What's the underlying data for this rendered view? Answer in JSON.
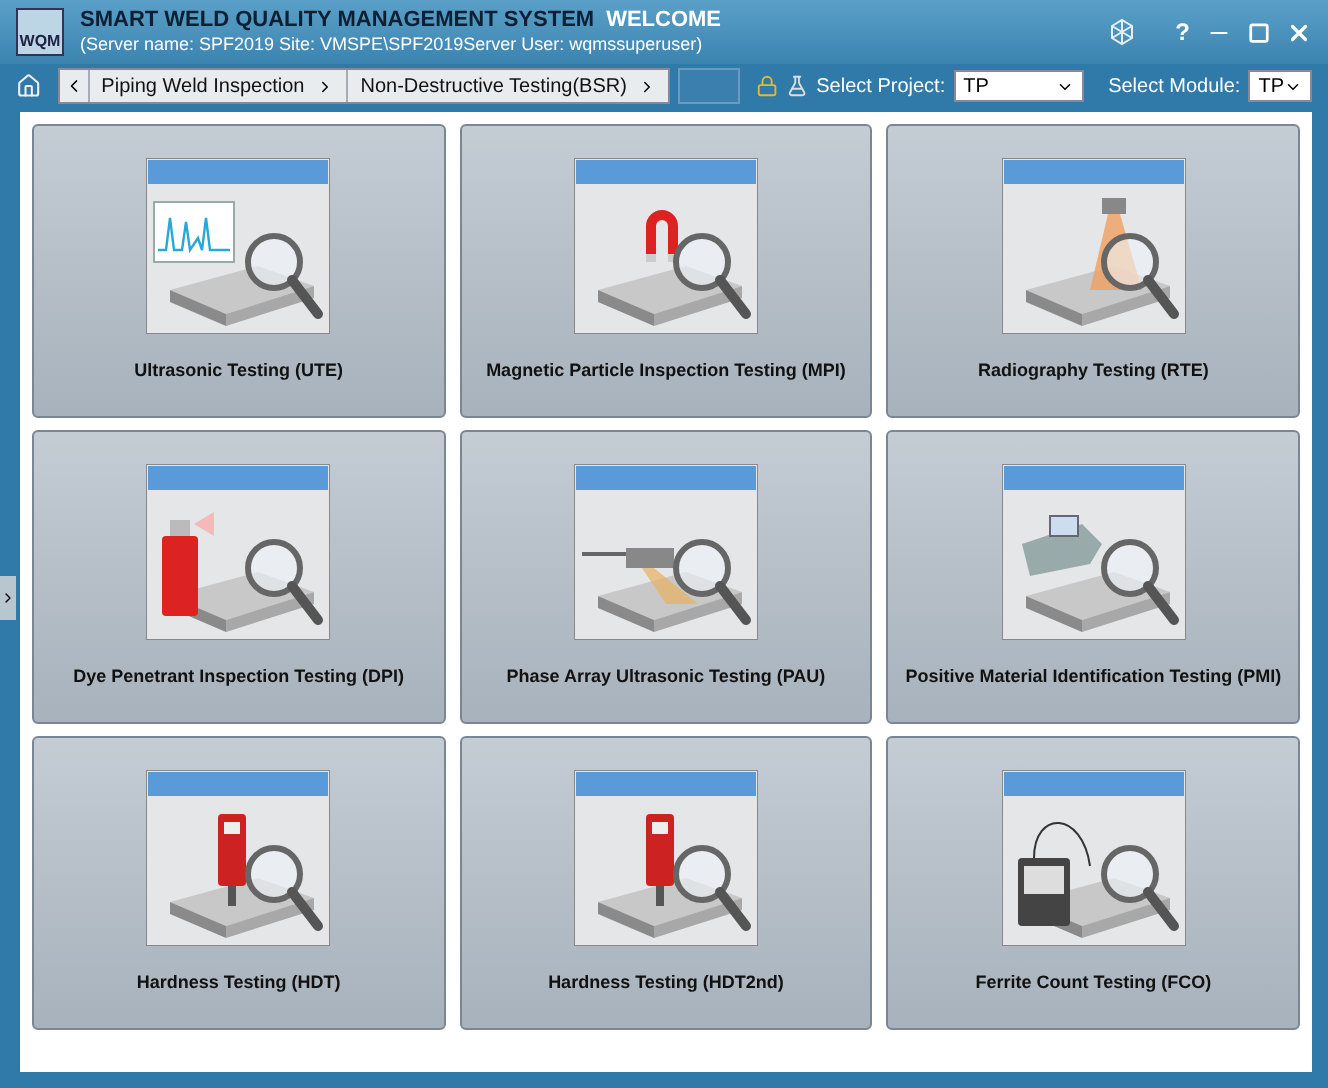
{
  "window": {
    "logo": "WQM",
    "title": "SMART WELD QUALITY MANAGEMENT SYSTEM",
    "welcome": "WELCOME",
    "server_info": "(Server name: SPF2019 Site: VMSPE\\SPF2019Server User: wqmssuperuser)",
    "help": "?"
  },
  "breadcrumb": [
    "Piping Weld Inspection",
    "Non-Destructive Testing(BSR)"
  ],
  "project": {
    "label": "Select Project:",
    "value": "TP"
  },
  "module": {
    "label": "Select Module:",
    "value": "TP"
  },
  "tiles": [
    {
      "label": "Ultrasonic Testing (UTE)",
      "kind": "wave"
    },
    {
      "label": "Magnetic Particle Inspection Testing (MPI)",
      "kind": "magnet"
    },
    {
      "label": "Radiography Testing (RTE)",
      "kind": "beam"
    },
    {
      "label": "Dye Penetrant Inspection Testing (DPI)",
      "kind": "spray"
    },
    {
      "label": "Phase Array Ultrasonic Testing (PAU)",
      "kind": "probe"
    },
    {
      "label": "Positive Material Identification Testing (PMI)",
      "kind": "analyzer"
    },
    {
      "label": "Hardness Testing (HDT)",
      "kind": "hardness"
    },
    {
      "label": "Hardness Testing (HDT2nd)",
      "kind": "hardness"
    },
    {
      "label": "Ferrite Count Testing (FCO)",
      "kind": "ferrite"
    }
  ]
}
